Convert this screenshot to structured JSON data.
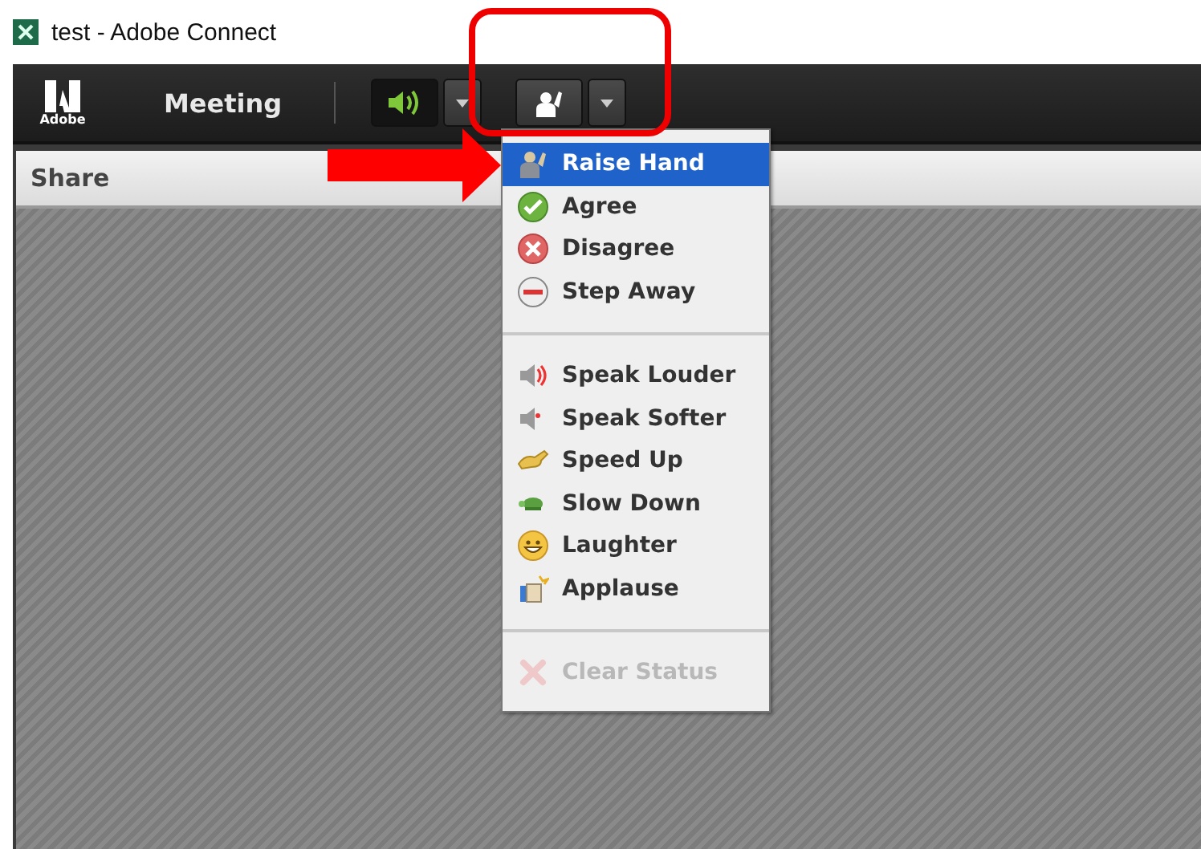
{
  "window": {
    "title": "test - Adobe Connect"
  },
  "toolbar": {
    "logo": "Adobe",
    "menu_label": "Meeting",
    "audio_on": true
  },
  "pod": {
    "title": "Share"
  },
  "status_menu": {
    "groups": [
      {
        "items": [
          {
            "label": "Raise Hand",
            "selected": true,
            "disabled": false
          },
          {
            "label": "Agree",
            "selected": false,
            "disabled": false
          },
          {
            "label": "Disagree",
            "selected": false,
            "disabled": false
          },
          {
            "label": "Step Away",
            "selected": false,
            "disabled": false
          }
        ]
      },
      {
        "items": [
          {
            "label": "Speak Louder",
            "selected": false,
            "disabled": false
          },
          {
            "label": "Speak Softer",
            "selected": false,
            "disabled": false
          },
          {
            "label": "Speed Up",
            "selected": false,
            "disabled": false
          },
          {
            "label": "Slow Down",
            "selected": false,
            "disabled": false
          },
          {
            "label": "Laughter",
            "selected": false,
            "disabled": false
          },
          {
            "label": "Applause",
            "selected": false,
            "disabled": false
          }
        ]
      },
      {
        "items": [
          {
            "label": "Clear Status",
            "selected": false,
            "disabled": true
          }
        ]
      }
    ]
  }
}
